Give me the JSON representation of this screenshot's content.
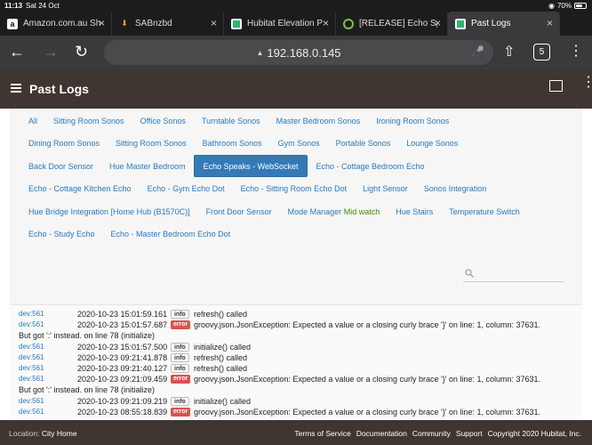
{
  "status_bar": {
    "time": "11:13",
    "date": "Sat 24 Oct",
    "battery": "70%",
    "battery_level": 0.7
  },
  "tabs": [
    {
      "label": "Amazon.com.au Sh",
      "icon": "amazon-icon",
      "active": false
    },
    {
      "label": "SABnzbd",
      "icon": "download-icon",
      "active": false
    },
    {
      "label": "Hubitat Elevation P",
      "icon": "hubitat-icon",
      "active": false
    },
    {
      "label": "[RELEASE] Echo Sp",
      "icon": "community-icon",
      "active": false
    },
    {
      "label": "Past Logs",
      "icon": "hubitat-icon",
      "active": true
    }
  ],
  "toolbar": {
    "url": "192.168.0.145",
    "tab_count": "5"
  },
  "header": {
    "title": "Past Logs"
  },
  "filters": {
    "rows": [
      [
        "All",
        "Sitting Room Sonos",
        "Office Sonos",
        "Turntable Sonos",
        "Master Bedroom Sonos",
        "Ironing Room Sonos"
      ],
      [
        "Dining Room Sonos",
        "Sitting Room Sonos",
        "Bathroom Sonos",
        "Gym Sonos",
        "Portable Sonos",
        "Lounge Sonos"
      ],
      [
        "Back Door Sensor",
        "Hue Master Bedroom",
        "Echo Speaks - WebSocket",
        "Echo - Cottage Bedroom Echo"
      ],
      [
        "Echo - Cottage Kitchen Echo",
        "Echo - Gym Echo Dot",
        "Echo - Sitting Room Echo Dot",
        "Light Sensor",
        "Sonos Integration"
      ],
      [
        "Hue Bridge Integration [Home Hub (B1570C)]",
        "Front Door Sensor",
        "Mode Manager",
        "Hue Stairs",
        "Temperature Switch"
      ],
      [
        "Echo - Study Echo",
        "Echo - Master Bedroom Echo Dot"
      ]
    ],
    "mode_manager_suffix": "Mid watch",
    "active": "Echo Speaks - WebSocket"
  },
  "logs": [
    {
      "dev": "dev:561",
      "ts": "2020-10-23 15:01:59.161",
      "level": "info",
      "msg": "refresh() called"
    },
    {
      "dev": "dev:561",
      "ts": "2020-10-23 15:01:57.687",
      "level": "error",
      "msg": "groovy.json.JsonException: Expected a value or a closing curly brace '}' on line: 1, column: 37631."
    },
    {
      "cont": "But got ':' instead. on line 78 (initialize)"
    },
    {
      "dev": "dev:561",
      "ts": "2020-10-23 15:01:57.500",
      "level": "info",
      "msg": "initialize() called"
    },
    {
      "dev": "dev:561",
      "ts": "2020-10-23 09:21:41.878",
      "level": "info",
      "msg": "refresh() called"
    },
    {
      "dev": "dev:561",
      "ts": "2020-10-23 09:21:40.127",
      "level": "info",
      "msg": "refresh() called"
    },
    {
      "dev": "dev:561",
      "ts": "2020-10-23 09:21:09.459",
      "level": "error",
      "msg": "groovy.json.JsonException: Expected a value or a closing curly brace '}' on line: 1, column: 37631."
    },
    {
      "cont": "But got ':' instead. on line 78 (initialize)"
    },
    {
      "dev": "dev:561",
      "ts": "2020-10-23 09:21:09.219",
      "level": "info",
      "msg": "initialize() called"
    },
    {
      "dev": "dev:561",
      "ts": "2020-10-23 08:55:18.839",
      "level": "error",
      "msg": "groovy.json.JsonException: Expected a value or a closing curly brace '}' on line: 1, column: 37631."
    }
  ],
  "footer": {
    "location_label": "Location:",
    "location_value": "City Home",
    "links": [
      "Terms of Service",
      "Documentation",
      "Community",
      "Support"
    ],
    "copyright": "Copyright 2020 Hubitat, Inc."
  }
}
